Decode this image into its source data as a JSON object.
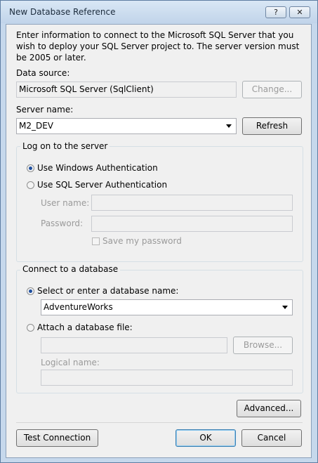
{
  "window": {
    "title": "New Database Reference",
    "help_glyph": "?",
    "close_glyph": "✕"
  },
  "intro": "Enter information to connect to the Microsoft SQL Server that you wish to deploy your SQL Server project to.  The server version must be 2005 or later.",
  "data_source": {
    "label": "Data source:",
    "value": "Microsoft SQL Server (SqlClient)",
    "change_button": "Change..."
  },
  "server": {
    "label": "Server name:",
    "value": "M2_DEV",
    "refresh_button": "Refresh"
  },
  "logon": {
    "title": "Log on to the server",
    "windows_auth": "Use Windows Authentication",
    "sql_auth": "Use SQL Server Authentication",
    "user_name_label": "User name:",
    "password_label": "Password:",
    "save_password": "Save my password",
    "selected": "windows"
  },
  "database": {
    "title": "Connect to a database",
    "select_label": "Select or enter a database name:",
    "selected_db": "AdventureWorks",
    "attach_label": "Attach a database file:",
    "browse_button": "Browse...",
    "logical_name_label": "Logical name:"
  },
  "buttons": {
    "advanced": "Advanced...",
    "test_connection": "Test Connection",
    "ok": "OK",
    "cancel": "Cancel"
  }
}
